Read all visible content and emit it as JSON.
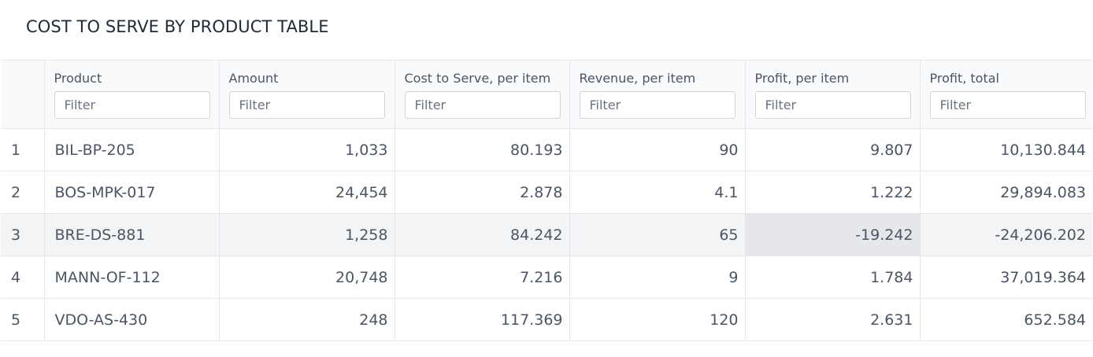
{
  "page": {
    "title": "COST TO SERVE BY PRODUCT TABLE"
  },
  "table": {
    "columns": [
      {
        "label": "Product",
        "filter_placeholder": "Filter"
      },
      {
        "label": "Amount",
        "filter_placeholder": "Filter"
      },
      {
        "label": "Cost to Serve, per item",
        "filter_placeholder": "Filter"
      },
      {
        "label": "Revenue, per item",
        "filter_placeholder": "Filter"
      },
      {
        "label": "Profit, per item",
        "filter_placeholder": "Filter"
      },
      {
        "label": "Profit, total",
        "filter_placeholder": "Filter"
      }
    ],
    "rows": [
      {
        "index": "1",
        "product": "BIL-BP-205",
        "amount": "1,033",
        "cost": "80.193",
        "revenue": "90",
        "profit_item": "9.807",
        "profit_total": "10,130.844"
      },
      {
        "index": "2",
        "product": "BOS-MPK-017",
        "amount": "24,454",
        "cost": "2.878",
        "revenue": "4.1",
        "profit_item": "1.222",
        "profit_total": "29,894.083"
      },
      {
        "index": "3",
        "product": "BRE-DS-881",
        "amount": "1,258",
        "cost": "84.242",
        "revenue": "65",
        "profit_item": "-19.242",
        "profit_total": "-24,206.202"
      },
      {
        "index": "4",
        "product": "MANN-OF-112",
        "amount": "20,748",
        "cost": "7.216",
        "revenue": "9",
        "profit_item": "1.784",
        "profit_total": "37,019.364"
      },
      {
        "index": "5",
        "product": "VDO-AS-430",
        "amount": "248",
        "cost": "117.369",
        "revenue": "120",
        "profit_item": "2.631",
        "profit_total": "652.584"
      }
    ],
    "highlighted_row": 3,
    "highlighted_cell": "profit_item"
  }
}
